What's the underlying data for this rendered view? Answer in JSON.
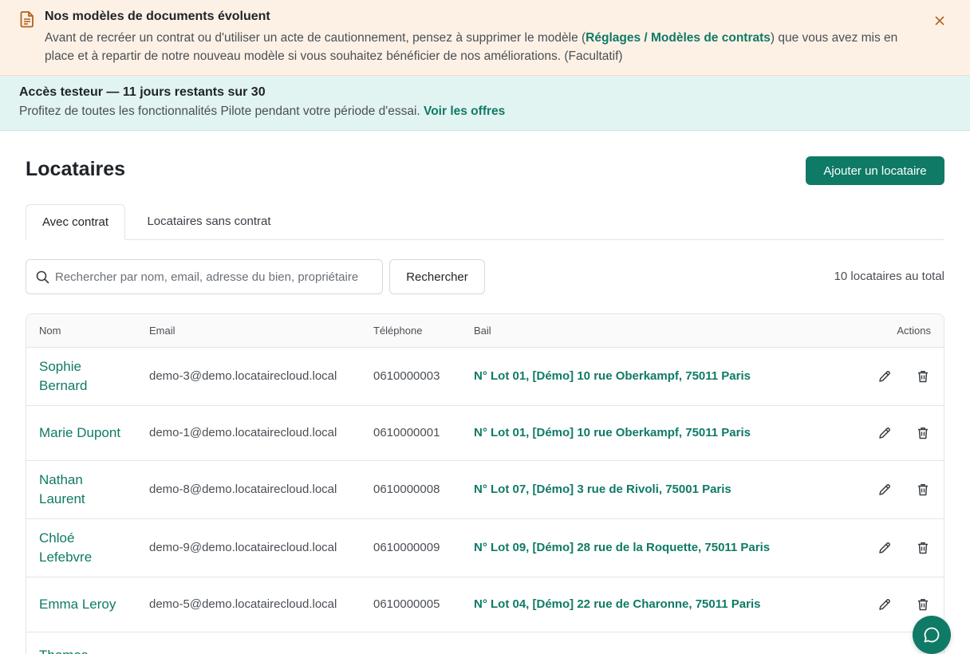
{
  "colors": {
    "accent": "#0f7a66",
    "notice_bg": "#fdf1e6",
    "trial_bg": "#e2f4f2"
  },
  "notice": {
    "icon": "document-icon",
    "title": "Nos modèles de documents évoluent",
    "body_before": "Avant de recréer un contrat ou d'utiliser un acte de cautionnement, pensez à supprimer le modèle (",
    "body_link": "Réglages / Modèles de contrats",
    "body_after": ") que vous avez mis en place et à repartir de notre nouveau modèle si vous souhaitez bénéficier de nos améliorations. (Facultatif)",
    "close_icon": "close-icon"
  },
  "trial": {
    "title": "Accès testeur — 11 jours restants sur 30",
    "body": "Profitez de toutes les fonctionnalités Pilote pendant votre période d'essai.",
    "link": "Voir les offres"
  },
  "header": {
    "title": "Locataires",
    "add_label": "Ajouter un locataire"
  },
  "tabs": [
    {
      "label": "Avec contrat",
      "active": true
    },
    {
      "label": "Locataires sans contrat",
      "active": false
    }
  ],
  "search": {
    "placeholder": "Rechercher par nom, email, adresse du bien, propriétaire",
    "value": "",
    "button_label": "Rechercher",
    "total": "10 locataires au total"
  },
  "table": {
    "columns": [
      "Nom",
      "Email",
      "Téléphone",
      "Bail",
      "Actions"
    ],
    "rows": [
      {
        "name": "Sophie Bernard",
        "email": "demo-3@demo.locatairecloud.local",
        "phone": "0610000003",
        "bail": "N° Lot 01, [Démo] 10 rue Oberkampf, 75011 Paris"
      },
      {
        "name": "Marie Dupont",
        "email": "demo-1@demo.locatairecloud.local",
        "phone": "0610000001",
        "bail": "N° Lot 01, [Démo] 10 rue Oberkampf, 75011 Paris"
      },
      {
        "name": "Nathan Laurent",
        "email": "demo-8@demo.locatairecloud.local",
        "phone": "0610000008",
        "bail": "N° Lot 07, [Démo] 3 rue de Rivoli, 75001 Paris"
      },
      {
        "name": "Chloé Lefebvre",
        "email": "demo-9@demo.locatairecloud.local",
        "phone": "0610000009",
        "bail": "N° Lot 09, [Démo] 28 rue de la Roquette, 75011 Paris"
      },
      {
        "name": "Emma Leroy",
        "email": "demo-5@demo.locatairecloud.local",
        "phone": "0610000005",
        "bail": "N° Lot 04, [Démo] 22 rue de Charonne, 75011 Paris"
      },
      {
        "name": "Thomas",
        "email": "",
        "phone": "",
        "bail": ""
      }
    ]
  },
  "chat": {
    "icon": "chat-bubble-icon"
  }
}
